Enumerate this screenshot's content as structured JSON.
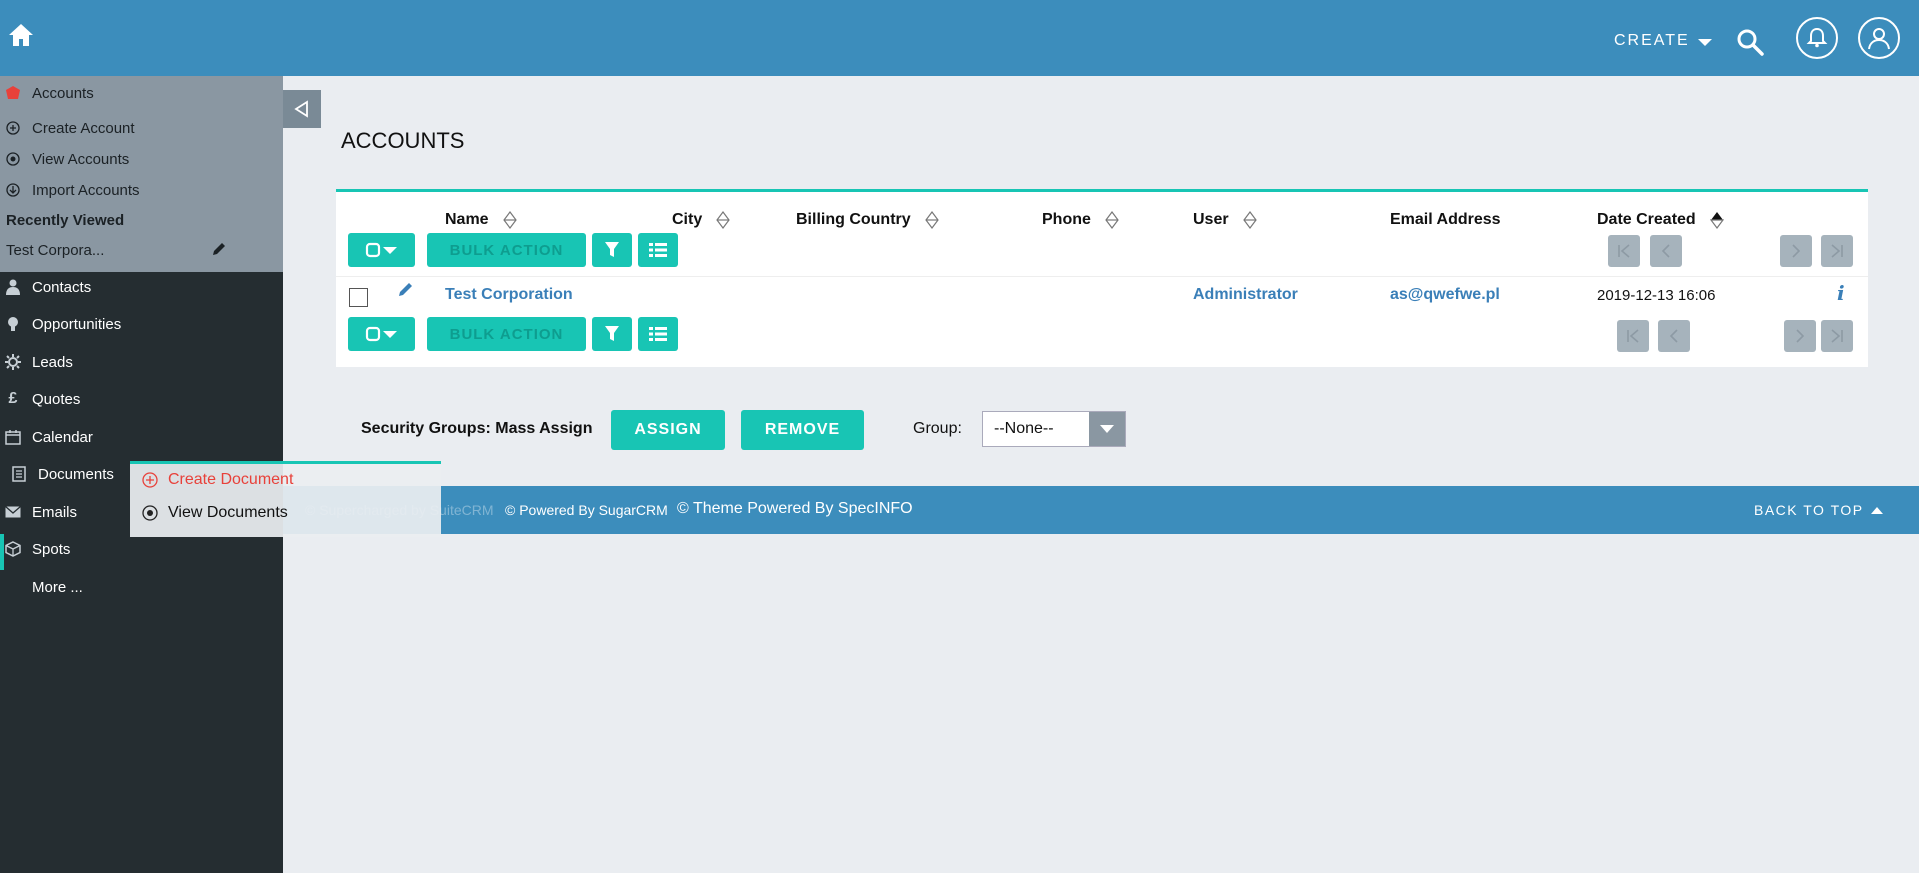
{
  "topbar": {
    "create_label": "CREATE",
    "icons": [
      "home-icon",
      "search-icon",
      "bell-icon",
      "user-icon"
    ],
    "color": "#3c8dbc"
  },
  "sidebar": {
    "module_title": "Accounts",
    "actions": [
      {
        "label": "Create Account",
        "icon": "plus-circle-icon"
      },
      {
        "label": "View Accounts",
        "icon": "eye-icon"
      },
      {
        "label": "Import Accounts",
        "icon": "import-icon"
      }
    ],
    "recent_title": "Recently Viewed",
    "recent_item": "Test Corpora...",
    "nav": [
      {
        "label": "Contacts",
        "icon": "person-icon"
      },
      {
        "label": "Opportunities",
        "icon": "lightbulb-icon"
      },
      {
        "label": "Leads",
        "icon": "gear-icon"
      },
      {
        "label": "Quotes",
        "icon": "pound-icon"
      },
      {
        "label": "Calendar",
        "icon": "calendar-icon"
      },
      {
        "label": "Documents",
        "icon": "document-icon"
      },
      {
        "label": "Emails",
        "icon": "mail-icon"
      },
      {
        "label": "Spots",
        "icon": "cube-icon"
      },
      {
        "label": "More ..."
      }
    ]
  },
  "popup": {
    "items": [
      {
        "label": "Create Document",
        "icon": "plus-circle-icon"
      },
      {
        "label": "View Documents",
        "icon": "eye-icon"
      }
    ]
  },
  "main": {
    "title": "ACCOUNTS",
    "columns": [
      "Name",
      "City",
      "Billing Country",
      "Phone",
      "User",
      "Email Address",
      "Date Created"
    ],
    "bulk_action_label": "BULK ACTION",
    "rows": [
      {
        "name": "Test Corporation",
        "city": "",
        "billing_country": "",
        "phone": "",
        "user": "Administrator",
        "email": "as@qwefwe.pl",
        "date_created": "2019-12-13 16:06"
      }
    ],
    "mass_assign_label": "Security Groups: Mass Assign",
    "assign_label": "ASSIGN",
    "remove_label": "REMOVE",
    "group_label": "Group:",
    "group_value": "--None--"
  },
  "footer": {
    "supercharged": "© Supercharged by SuiteCRM",
    "powered_sugar": "© Powered By SugarCRM",
    "theme": "© Theme Powered By SpecINFO",
    "back_to_top": "BACK TO TOP"
  },
  "colors": {
    "accent": "#18c5b4",
    "link": "#3a7fb8",
    "sidebar_dark": "#252d31",
    "sidebar_top": "#8a97a2",
    "danger": "#e8413a"
  }
}
